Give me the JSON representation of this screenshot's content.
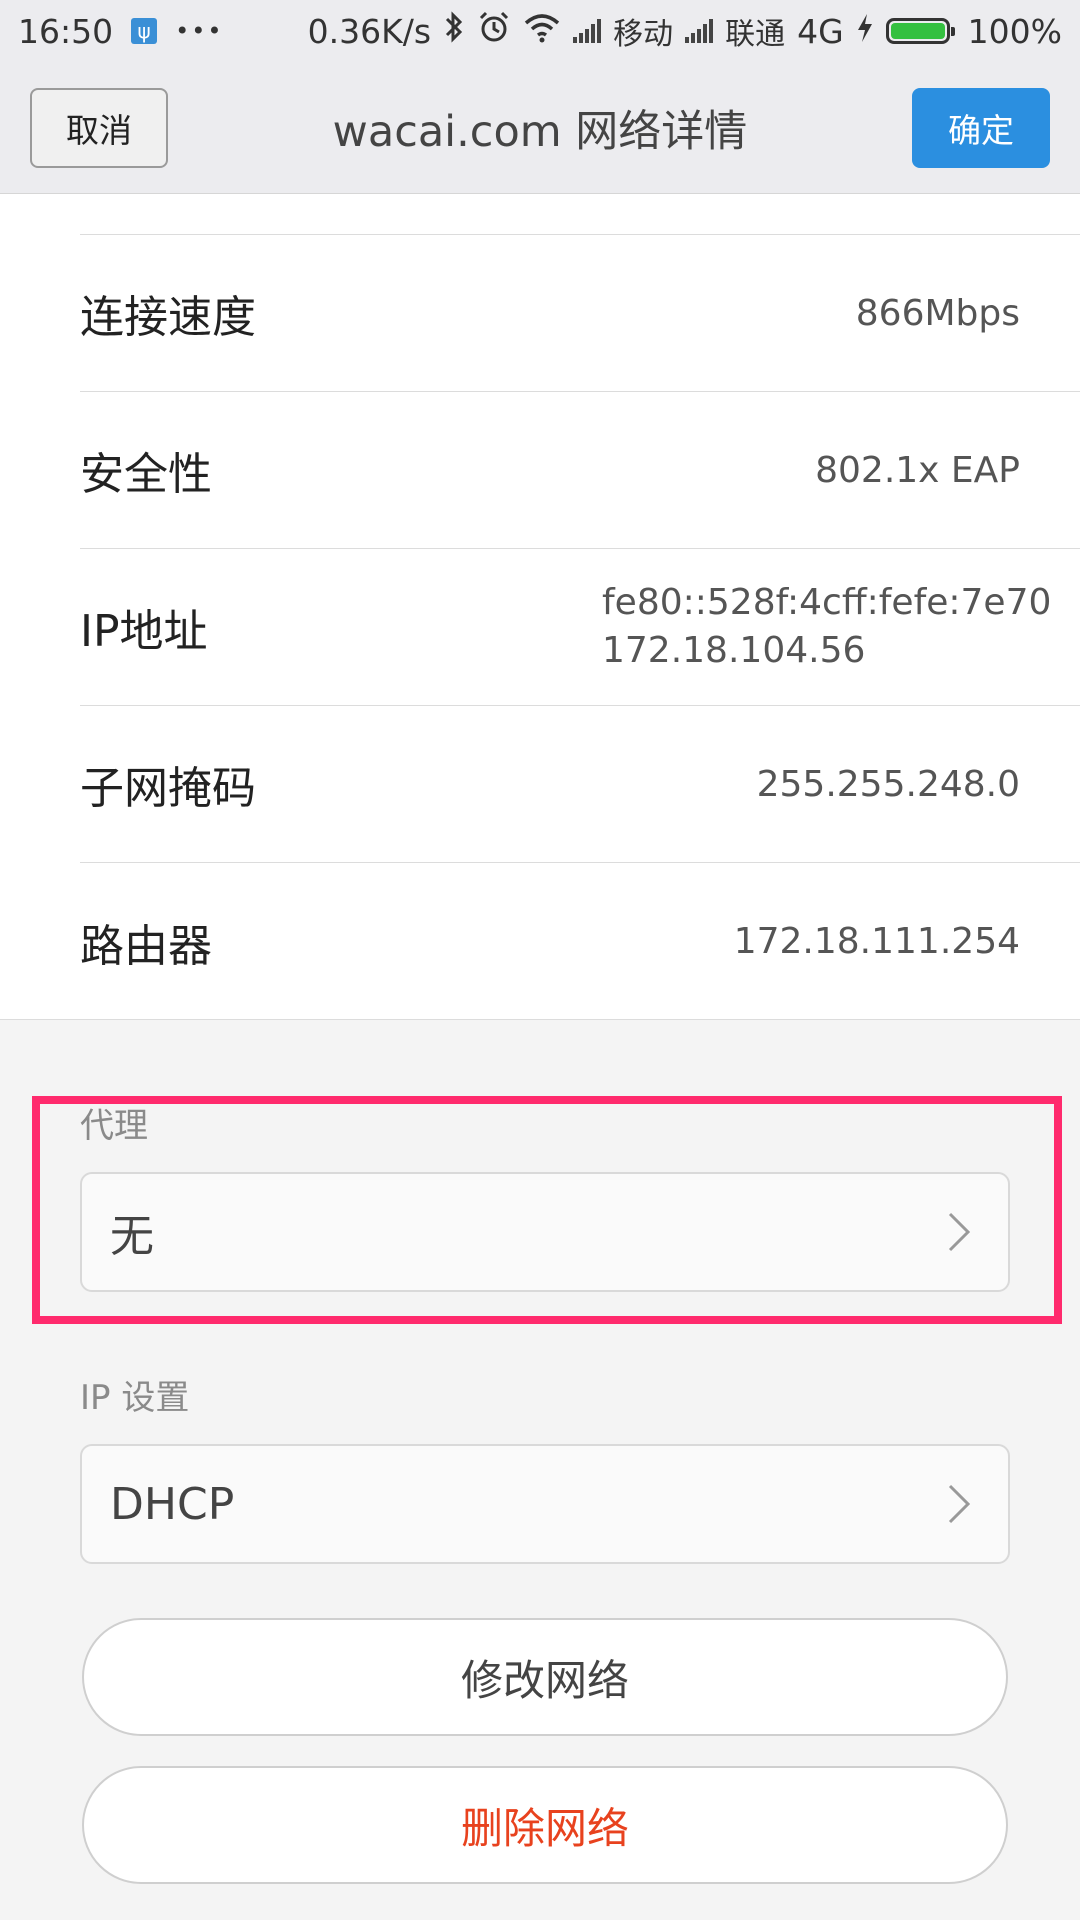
{
  "status_bar": {
    "time": "16:50",
    "usb_glyph": "ψ",
    "dots": "•••",
    "speed": "0.36K/s",
    "carrier1": "移动",
    "carrier2": "联通",
    "network_type": "4G",
    "battery": "100%",
    "icons": [
      "usb-icon",
      "bluetooth-icon",
      "alarm-icon",
      "wifi-icon",
      "signal-icon",
      "charging-icon",
      "battery-icon"
    ]
  },
  "header": {
    "cancel_label": "取消",
    "title": "wacai.com 网络详情",
    "confirm_label": "确定",
    "confirm_color": "#2b8fe0"
  },
  "details": [
    {
      "label": "连接速度",
      "value": "866Mbps"
    },
    {
      "label": "安全性",
      "value": "802.1x EAP"
    },
    {
      "label": "IP地址",
      "value_lines": [
        "fe80::528f:4cff:fefe:7e70",
        "172.18.104.56"
      ]
    },
    {
      "label": "子网掩码",
      "value": "255.255.248.0"
    },
    {
      "label": "路由器",
      "value": "172.18.111.254"
    }
  ],
  "proxy": {
    "label": "代理",
    "value": "无",
    "highlight_color": "#ff2a6d"
  },
  "ip_settings": {
    "label": "IP 设置",
    "value": "DHCP"
  },
  "actions": {
    "modify_label": "修改网络",
    "delete_label": "删除网络",
    "delete_color": "#e8421e"
  }
}
